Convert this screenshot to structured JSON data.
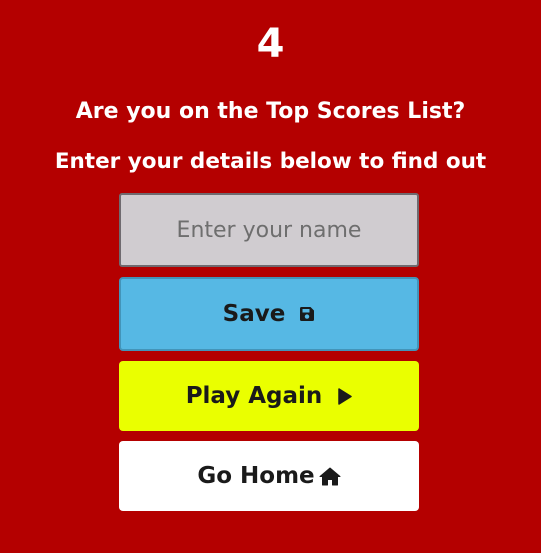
{
  "score": "4",
  "headings": {
    "question": "Are you on the Top Scores List?",
    "instruction": "Enter your details below to find out"
  },
  "name_input": {
    "placeholder": "Enter your name",
    "value": ""
  },
  "buttons": {
    "save": {
      "label": "Save",
      "icon": "floppy-disk-icon",
      "color": "#56b8e4"
    },
    "play_again": {
      "label": "Play Again",
      "icon": "play-icon",
      "color": "#eaff00"
    },
    "go_home": {
      "label": "Go Home",
      "icon": "home-icon",
      "color": "#ffffff"
    }
  },
  "colors": {
    "background": "#b40000",
    "text": "#ffffff"
  }
}
